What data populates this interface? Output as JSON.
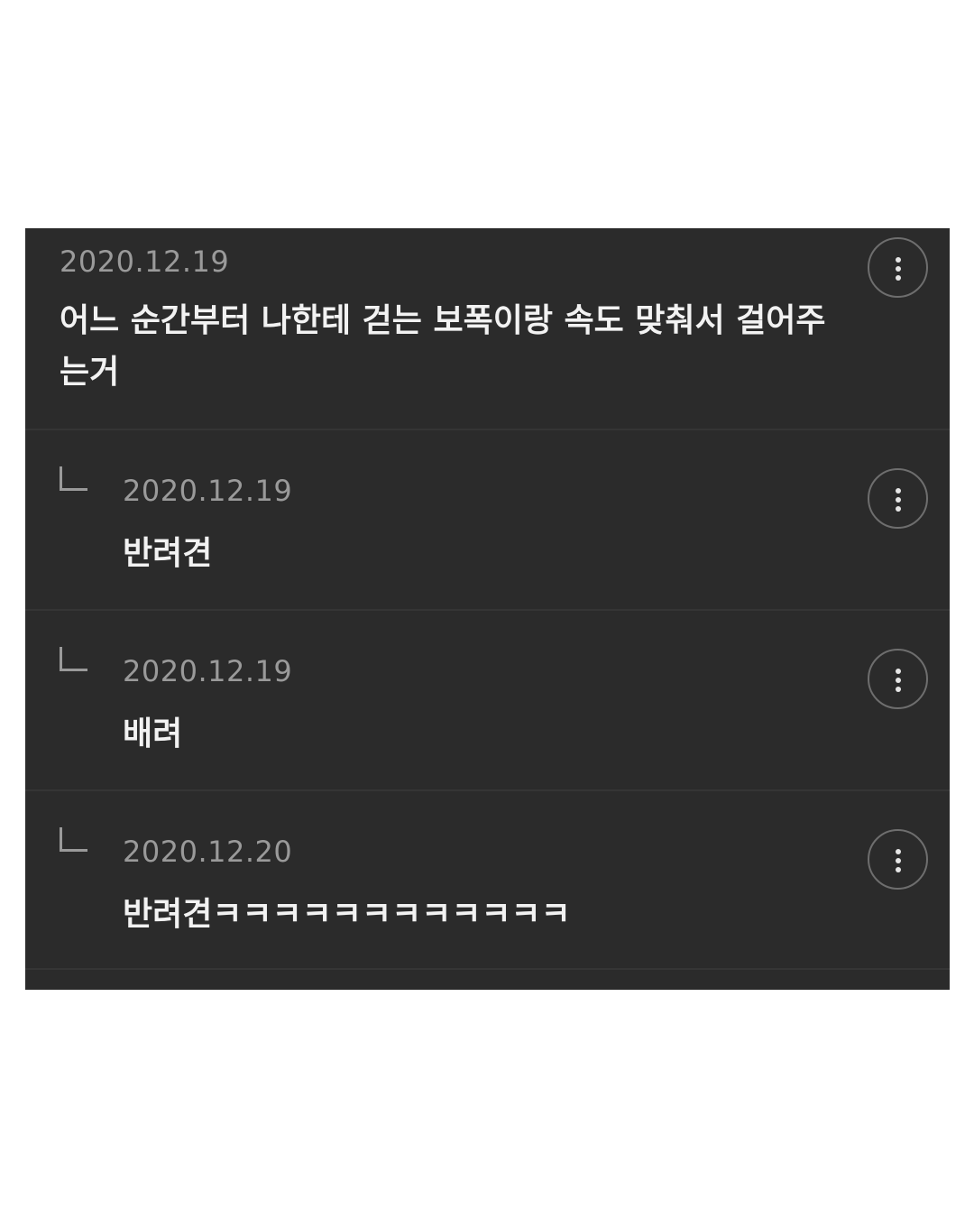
{
  "comments": [
    {
      "date": "2020.12.19",
      "text": "어느 순간부터 나한테 걷는 보폭이랑 속도 맞춰서 걸어주는거",
      "menu_icon": "more-vertical-icon"
    },
    {
      "date": "2020.12.19",
      "text": "반려견",
      "reply_icon": "reply-arrow-icon",
      "menu_icon": "more-vertical-icon"
    },
    {
      "date": "2020.12.19",
      "text": "배려",
      "reply_icon": "reply-arrow-icon",
      "menu_icon": "more-vertical-icon"
    },
    {
      "date": "2020.12.20",
      "text": "반려견ㅋㅋㅋㅋㅋㅋㅋㅋㅋㅋㅋㅋ",
      "reply_icon": "reply-arrow-icon",
      "menu_icon": "more-vertical-icon"
    }
  ],
  "colors": {
    "panel_bg": "#2b2b2b",
    "date": "#9a9a9a",
    "text": "#f2f2f2",
    "divider": "#353535"
  }
}
